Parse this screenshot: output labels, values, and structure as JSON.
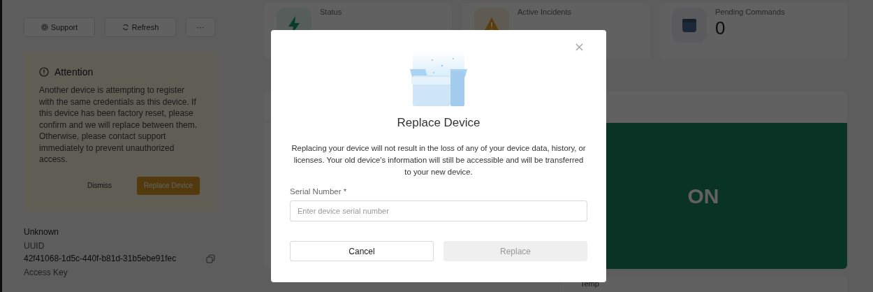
{
  "sidebar": {
    "buttons": [
      {
        "label": "Support"
      },
      {
        "label": "Refresh"
      },
      {
        "label": "···"
      }
    ],
    "alert": {
      "title": "Attention",
      "message": "Another device is attempting to register with the same credentials as this device. If this device has been factory reset, please confirm and we will replace between them. Otherwise, please contact support immediately to prevent unauthorized access.",
      "actions": [
        {
          "label": "Dismiss",
          "kind": "text"
        },
        {
          "label": "Replace Device",
          "kind": "primary"
        }
      ]
    },
    "fields": [
      {
        "value": "Unknown"
      },
      {
        "label": "UUID",
        "value": "42f41068-1d5c-440f-b81d-31b5ebe91fec"
      },
      {
        "label": "Access Key"
      }
    ]
  },
  "stats": [
    {
      "label": "Status"
    },
    {
      "label": "Active Incidents"
    },
    {
      "label": "Pending Commands",
      "value": "0"
    }
  ],
  "power_panel": {
    "state": "ON"
  },
  "temp_card": {
    "title": "Temp"
  },
  "modal": {
    "title": "Replace Device",
    "description": "Replacing your device will not result in the loss of any of your device data, history, or licenses. Your old device's information will still be accessible and will be transferred to your new device.",
    "field": {
      "label": "Serial Number *",
      "placeholder": "Enter device serial number"
    },
    "buttons": [
      {
        "label": "Cancel",
        "disabled": false
      },
      {
        "label": "Replace",
        "disabled": true
      }
    ]
  }
}
